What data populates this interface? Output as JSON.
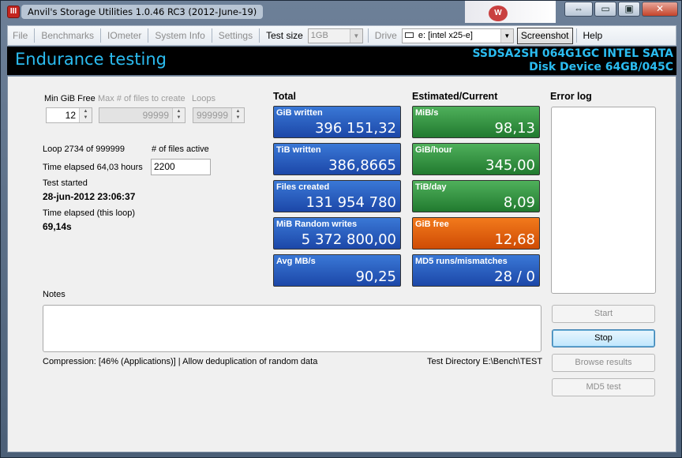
{
  "window": {
    "title": "Anvil's Storage Utilities 1.0.46 RC3 (2012-June-19)",
    "app_icon_letter": "III",
    "title_art_text": "W",
    "caption": {
      "restore_glyph": "⇔",
      "minimize_glyph": "▭",
      "maximize_glyph": "▣",
      "close_glyph": "✕"
    }
  },
  "menubar": {
    "file": "File",
    "benchmarks": "Benchmarks",
    "iometer": "IOmeter",
    "system_info": "System Info",
    "settings": "Settings",
    "test_size_label": "Test size",
    "test_size_value": "1GB",
    "drive_label": "Drive",
    "drive_value": "e: [intel x25-e]",
    "screenshot": "Screenshot",
    "help": "Help"
  },
  "header": {
    "title": "Endurance testing",
    "device_line1": "SSDSA2SH 064G1GC INTEL SATA",
    "device_line2": "Disk Device 64GB/045C"
  },
  "settings": {
    "min_gib_free_label": "Min GiB Free",
    "min_gib_free_value": "12",
    "max_files_label": "Max # of files to create",
    "max_files_value": "99999",
    "loops_label": "Loops",
    "loops_value": "999999"
  },
  "status": {
    "loop_text": "Loop 2734 of 999999",
    "files_active_label": "# of files active",
    "files_active_value": "2200",
    "time_elapsed_text": "Time elapsed 64,03 hours",
    "test_started_label": "Test started",
    "test_started_value": "28-jun-2012 23:06:37",
    "loop_elapsed_label": "Time elapsed (this loop)",
    "loop_elapsed_value": "69,14s"
  },
  "total": {
    "heading": "Total",
    "tiles": [
      {
        "label": "GiB written",
        "value": "396 151,32"
      },
      {
        "label": "TiB written",
        "value": "386,8665"
      },
      {
        "label": "Files created",
        "value": "131 954 780"
      },
      {
        "label": "MiB Random writes",
        "value": "5 372 800,00"
      },
      {
        "label": "Avg MB/s",
        "value": "90,25"
      }
    ]
  },
  "estimated": {
    "heading": "Estimated/Current",
    "tiles": [
      {
        "label": "MiB/s",
        "value": "98,13"
      },
      {
        "label": "GiB/hour",
        "value": "345,00"
      },
      {
        "label": "TiB/day",
        "value": "8,09"
      },
      {
        "label": "GiB free",
        "value": "12,68"
      },
      {
        "label": "MD5 runs/mismatches",
        "value": "28 / 0"
      }
    ]
  },
  "error_log": {
    "heading": "Error log"
  },
  "notes": {
    "label": "Notes"
  },
  "footer": {
    "compression": "Compression: [46% (Applications)] | Allow deduplication of random data",
    "test_directory": "Test Directory E:\\Bench\\TEST"
  },
  "buttons": {
    "start": "Start",
    "stop": "Stop",
    "browse": "Browse results",
    "md5": "MD5 test"
  },
  "colors": {
    "accent_cyan": "#2bbcf0",
    "tile_blue": "#1c47a8",
    "tile_green": "#217a2f",
    "tile_orange": "#cf4b04"
  }
}
